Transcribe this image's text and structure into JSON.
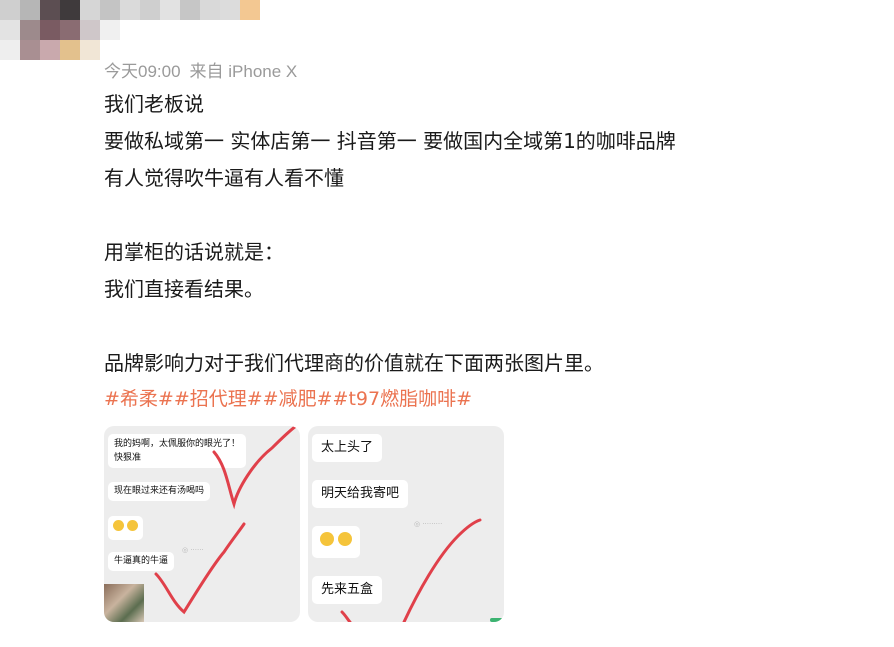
{
  "post": {
    "time": "今天09:00",
    "source": "来自 iPhone X"
  },
  "body_lines": [
    "我们老板说",
    "要做私域第一 实体店第一 抖音第一 要做国内全域第1的咖啡品牌",
    "有人觉得吹牛逼有人看不懂",
    "",
    "用掌柜的话说就是：",
    "我们直接看结果。",
    "",
    "品牌影响力对于我们代理商的价值就在下面两张图片里。"
  ],
  "hashtags": "#希柔##招代理##减肥##t97燃脂咖啡#",
  "images": [
    {
      "bubbles": [
        "我的妈啊，太佩服你的眼光了！",
        "快狠准",
        "现在眼过来还有汤喝吗",
        "牛逼真的牛逼"
      ]
    },
    {
      "bubbles": [
        "太上头了",
        "明天给我寄吧",
        "先来五盒"
      ]
    }
  ],
  "colors": {
    "hashtag": "#eb7350",
    "meta": "#9a9a9a",
    "scribble": "#e0404a",
    "thumb_bg": "#ededed"
  }
}
